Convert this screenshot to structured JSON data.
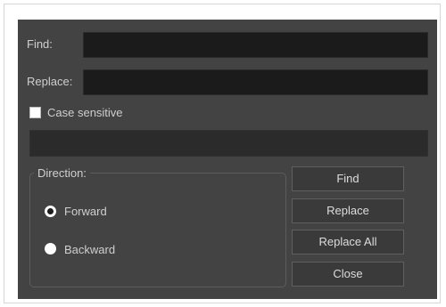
{
  "find": {
    "label": "Find:",
    "value": ""
  },
  "replace": {
    "label": "Replace:",
    "value": ""
  },
  "case_sensitive": {
    "label": "Case sensitive",
    "checked": false
  },
  "status_message": "",
  "direction": {
    "title": "Direction:",
    "options": [
      {
        "label": "Forward",
        "selected": true
      },
      {
        "label": "Backward",
        "selected": false
      }
    ]
  },
  "buttons": {
    "find": "Find",
    "replace": "Replace",
    "replace_all": "Replace All",
    "close": "Close"
  }
}
